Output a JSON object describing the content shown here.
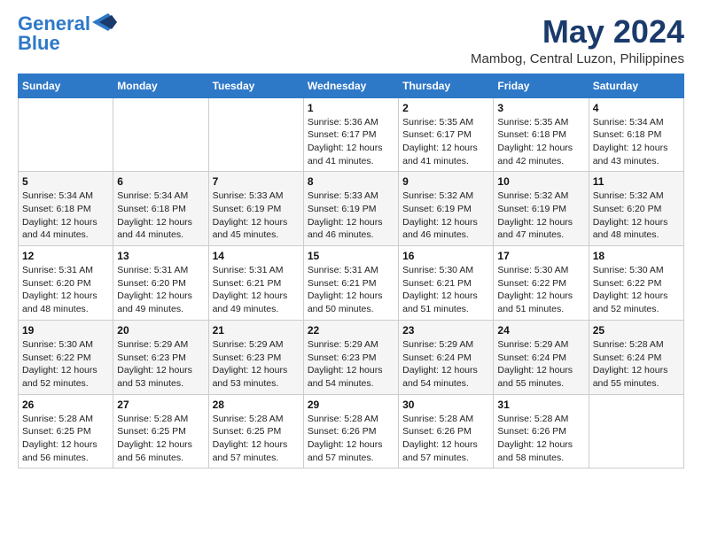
{
  "logo": {
    "line1": "General",
    "line2": "Blue"
  },
  "title": "May 2024",
  "subtitle": "Mambog, Central Luzon, Philippines",
  "days_header": [
    "Sunday",
    "Monday",
    "Tuesday",
    "Wednesday",
    "Thursday",
    "Friday",
    "Saturday"
  ],
  "weeks": [
    [
      {
        "day": "",
        "info": ""
      },
      {
        "day": "",
        "info": ""
      },
      {
        "day": "",
        "info": ""
      },
      {
        "day": "1",
        "info": "Sunrise: 5:36 AM\nSunset: 6:17 PM\nDaylight: 12 hours\nand 41 minutes."
      },
      {
        "day": "2",
        "info": "Sunrise: 5:35 AM\nSunset: 6:17 PM\nDaylight: 12 hours\nand 41 minutes."
      },
      {
        "day": "3",
        "info": "Sunrise: 5:35 AM\nSunset: 6:18 PM\nDaylight: 12 hours\nand 42 minutes."
      },
      {
        "day": "4",
        "info": "Sunrise: 5:34 AM\nSunset: 6:18 PM\nDaylight: 12 hours\nand 43 minutes."
      }
    ],
    [
      {
        "day": "5",
        "info": "Sunrise: 5:34 AM\nSunset: 6:18 PM\nDaylight: 12 hours\nand 44 minutes."
      },
      {
        "day": "6",
        "info": "Sunrise: 5:34 AM\nSunset: 6:18 PM\nDaylight: 12 hours\nand 44 minutes."
      },
      {
        "day": "7",
        "info": "Sunrise: 5:33 AM\nSunset: 6:19 PM\nDaylight: 12 hours\nand 45 minutes."
      },
      {
        "day": "8",
        "info": "Sunrise: 5:33 AM\nSunset: 6:19 PM\nDaylight: 12 hours\nand 46 minutes."
      },
      {
        "day": "9",
        "info": "Sunrise: 5:32 AM\nSunset: 6:19 PM\nDaylight: 12 hours\nand 46 minutes."
      },
      {
        "day": "10",
        "info": "Sunrise: 5:32 AM\nSunset: 6:19 PM\nDaylight: 12 hours\nand 47 minutes."
      },
      {
        "day": "11",
        "info": "Sunrise: 5:32 AM\nSunset: 6:20 PM\nDaylight: 12 hours\nand 48 minutes."
      }
    ],
    [
      {
        "day": "12",
        "info": "Sunrise: 5:31 AM\nSunset: 6:20 PM\nDaylight: 12 hours\nand 48 minutes."
      },
      {
        "day": "13",
        "info": "Sunrise: 5:31 AM\nSunset: 6:20 PM\nDaylight: 12 hours\nand 49 minutes."
      },
      {
        "day": "14",
        "info": "Sunrise: 5:31 AM\nSunset: 6:21 PM\nDaylight: 12 hours\nand 49 minutes."
      },
      {
        "day": "15",
        "info": "Sunrise: 5:31 AM\nSunset: 6:21 PM\nDaylight: 12 hours\nand 50 minutes."
      },
      {
        "day": "16",
        "info": "Sunrise: 5:30 AM\nSunset: 6:21 PM\nDaylight: 12 hours\nand 51 minutes."
      },
      {
        "day": "17",
        "info": "Sunrise: 5:30 AM\nSunset: 6:22 PM\nDaylight: 12 hours\nand 51 minutes."
      },
      {
        "day": "18",
        "info": "Sunrise: 5:30 AM\nSunset: 6:22 PM\nDaylight: 12 hours\nand 52 minutes."
      }
    ],
    [
      {
        "day": "19",
        "info": "Sunrise: 5:30 AM\nSunset: 6:22 PM\nDaylight: 12 hours\nand 52 minutes."
      },
      {
        "day": "20",
        "info": "Sunrise: 5:29 AM\nSunset: 6:23 PM\nDaylight: 12 hours\nand 53 minutes."
      },
      {
        "day": "21",
        "info": "Sunrise: 5:29 AM\nSunset: 6:23 PM\nDaylight: 12 hours\nand 53 minutes."
      },
      {
        "day": "22",
        "info": "Sunrise: 5:29 AM\nSunset: 6:23 PM\nDaylight: 12 hours\nand 54 minutes."
      },
      {
        "day": "23",
        "info": "Sunrise: 5:29 AM\nSunset: 6:24 PM\nDaylight: 12 hours\nand 54 minutes."
      },
      {
        "day": "24",
        "info": "Sunrise: 5:29 AM\nSunset: 6:24 PM\nDaylight: 12 hours\nand 55 minutes."
      },
      {
        "day": "25",
        "info": "Sunrise: 5:28 AM\nSunset: 6:24 PM\nDaylight: 12 hours\nand 55 minutes."
      }
    ],
    [
      {
        "day": "26",
        "info": "Sunrise: 5:28 AM\nSunset: 6:25 PM\nDaylight: 12 hours\nand 56 minutes."
      },
      {
        "day": "27",
        "info": "Sunrise: 5:28 AM\nSunset: 6:25 PM\nDaylight: 12 hours\nand 56 minutes."
      },
      {
        "day": "28",
        "info": "Sunrise: 5:28 AM\nSunset: 6:25 PM\nDaylight: 12 hours\nand 57 minutes."
      },
      {
        "day": "29",
        "info": "Sunrise: 5:28 AM\nSunset: 6:26 PM\nDaylight: 12 hours\nand 57 minutes."
      },
      {
        "day": "30",
        "info": "Sunrise: 5:28 AM\nSunset: 6:26 PM\nDaylight: 12 hours\nand 57 minutes."
      },
      {
        "day": "31",
        "info": "Sunrise: 5:28 AM\nSunset: 6:26 PM\nDaylight: 12 hours\nand 58 minutes."
      },
      {
        "day": "",
        "info": ""
      }
    ]
  ]
}
